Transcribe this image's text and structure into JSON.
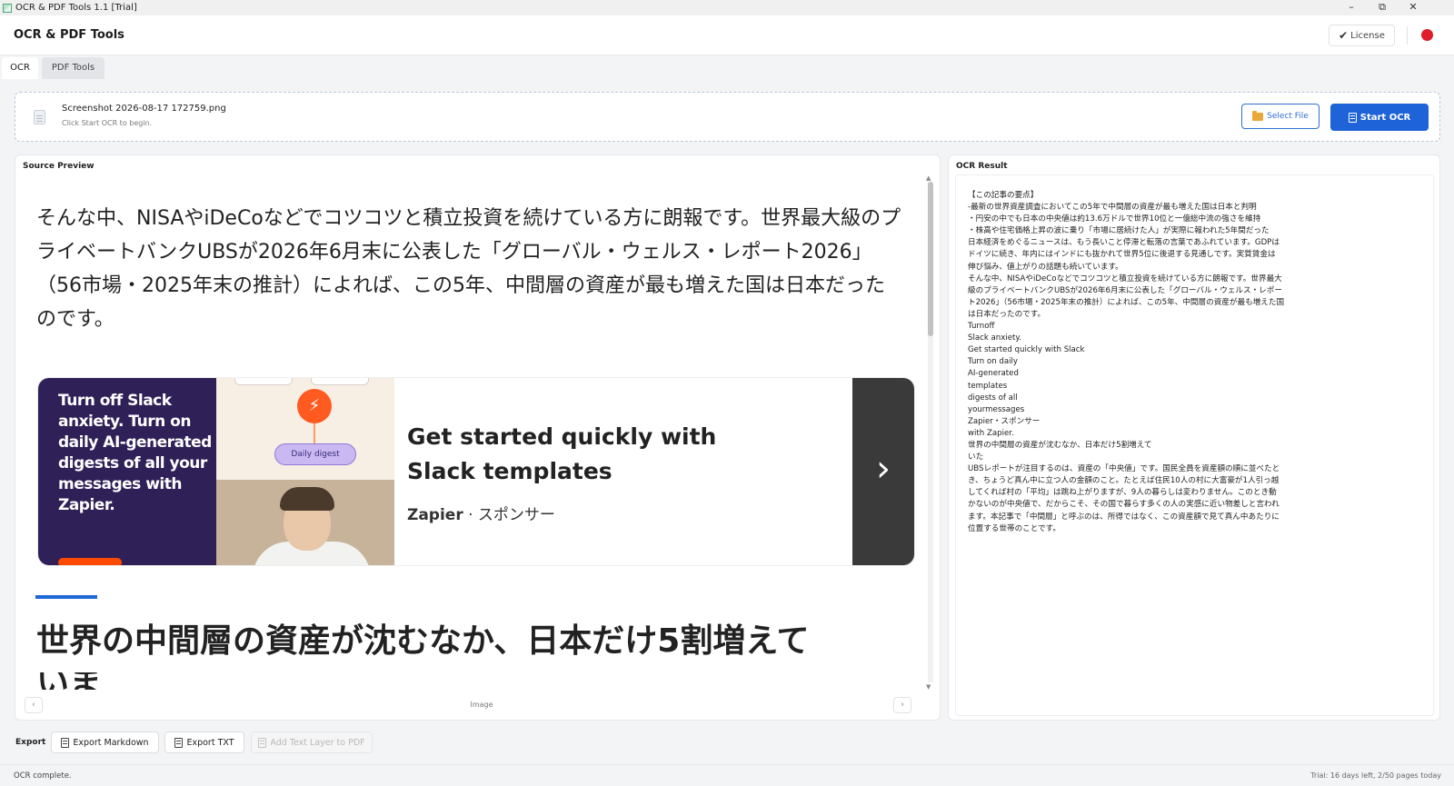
{
  "window": {
    "title": "OCR & PDF Tools 1.1 [Trial]",
    "controls": {
      "minimize": "–",
      "maximize": "⧉",
      "close": "✕"
    }
  },
  "header": {
    "app_title": "OCR & PDF Tools",
    "license_label": "License",
    "status_dot_color": "#e11b2a"
  },
  "tabs": [
    {
      "label": "OCR",
      "active": true
    },
    {
      "label": "PDF Tools",
      "active": false
    }
  ],
  "file": {
    "name": "Screenshot 2026-08-17 172759.png",
    "hint": "Click Start OCR to begin.",
    "select_label": "Select File",
    "start_label": "Start OCR"
  },
  "preview": {
    "title": "Source Preview",
    "paragraph": "そんな中、NISAやiDeCoなどでコツコツと積立投資を続けている方に朗報です。世界最大級のプライベートバンクUBSが2026年6月末に公表した「グローバル・ウェルス・レポート2026」（56市場・2025年末の推計）によれば、この5年、中間層の資産が最も増えた国は日本だったのです。",
    "ad": {
      "left_text": "Turn off Slack anxiety. Turn on daily AI-generated digests of all your messages with Zapier.",
      "pill": "Daily digest",
      "headline": "Get started quickly with Slack templates",
      "sponsor_brand": "Zapier",
      "sponsor_suffix": "· スポンサー"
    },
    "heading": "世界の中間層の資産が沈むなか、日本だけ5割増えて",
    "heading_cut": "いま",
    "image_label": "Image",
    "prev": "‹",
    "next": "›"
  },
  "result": {
    "title": "OCR Result",
    "text": "【この記事の要点】\n-最新の世界資産調査においてこの5年で中間層の資産が最も増えた国は日本と判明\n・円安の中でも日本の中央値は約13.6万ドルで世界10位と一億総中流の強さを維持\n・株高や住宅価格上昇の波に乗り「市場に居続けた人」が実際に報われた5年間だった\n日本経済をめぐるニュースは、もう長いこと停滞と転落の言葉であふれています。GDPは\nドイツに続き、年内にはインドにも抜かれて世界5位に後退する見通しです。実質賃金は\n伸び悩み、値上がりの話題も続いています。\nそんな中、NISAやiDeCoなどでコツコツと積立投資を続けている方に朗報です。世界最大\n級のプライベートバンクUBSが2026年6月末に公表した「グローバル・ウェルス・レポー\nト2026」（56市場・2025年末の推計）によれば、この5年、中間層の資産が最も増えた国\nは日本だったのです。\nTurnoff\nSlack anxiety.\nGet started quickly with Slack\nTurn on daily\nAI-generated\ntemplates\ndigests of all\nyourmessages\nZapier・スポンサー\nwith Zapier.\n世界の中間層の資産が沈むなか、日本だけ5割増えて\nいた\nUBSレポートが注目するのは、資産の「中央値」です。国民全員を資産額の順に並べたと\nき、ちょうど真ん中に立つ人の金額のこと。たとえば住民10人の村に大富豪が1人引っ越\nしてくれば村の「平均」は跳ね上がりますが、9人の暮らしは変わりません。このとき動\nかないのが中央値で、だからこそ、その国で暮らす多くの人の実感に近い物差しと言われ\nます。本記事で「中間層」と呼ぶのは、所得ではなく、この資産額で見て真ん中あたりに\n位置する世帯のことです。"
  },
  "export": {
    "label": "Export",
    "markdown_label": "Export Markdown",
    "txt_label": "Export TXT",
    "text_layer_label": "Add Text Layer to PDF"
  },
  "status": {
    "left": "OCR complete.",
    "right": "Trial: 16 days left, 2/50 pages today"
  },
  "colors": {
    "accent": "#1e63d8",
    "ad_purple": "#2f2057",
    "zapier_orange": "#ff4a00"
  }
}
